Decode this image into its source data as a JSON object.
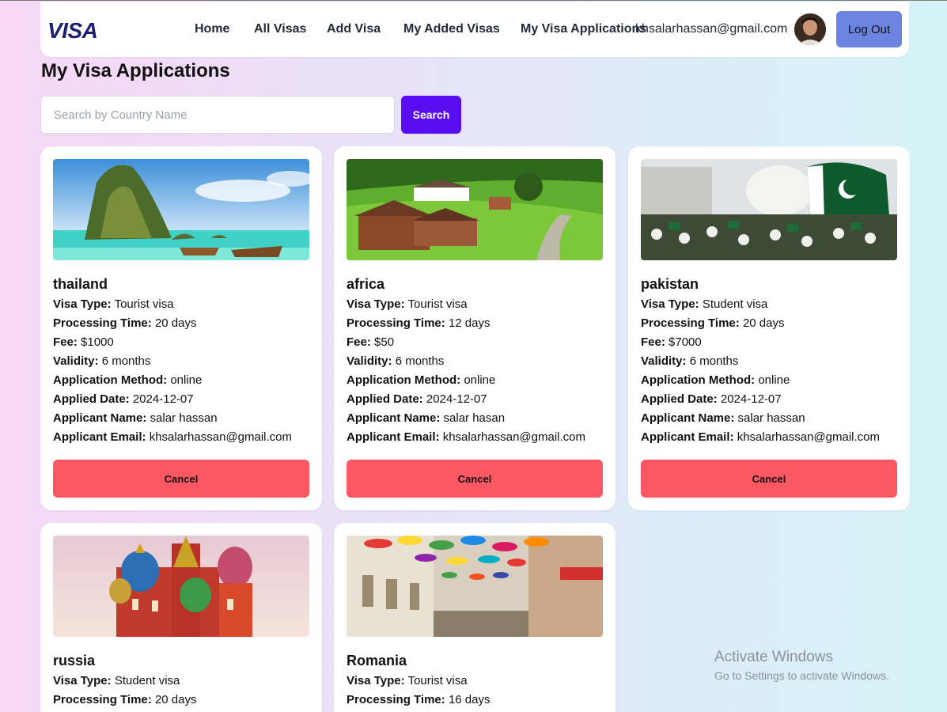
{
  "navbar": {
    "logo": "VISA",
    "links": [
      "Home",
      "All Visas",
      "Add Visa",
      "My Added Visas",
      "My Visa Applications"
    ],
    "user_email": "khsalarhassan@gmail.com",
    "logout_label": "Log Out"
  },
  "page": {
    "title": "My Visa Applications"
  },
  "search": {
    "placeholder": "Search by Country Name",
    "button_label": "Search"
  },
  "labels": {
    "visa_type": "Visa Type:",
    "processing_time": "Processing Time:",
    "fee": "Fee:",
    "validity": "Validity:",
    "application_method": "Application Method:",
    "applied_date": "Applied Date:",
    "applicant_name": "Applicant Name:",
    "applicant_email": "Applicant Email:",
    "cancel": "Cancel"
  },
  "applications": [
    {
      "country": "thailand",
      "visa_type": "Tourist visa",
      "processing_time": "20 days",
      "fee": "$1000",
      "validity": "6 months",
      "application_method": "online",
      "applied_date": "2024-12-07",
      "applicant_name": "salar hassan",
      "applicant_email": "khsalarhassan@gmail.com",
      "image": "thailand-beach-photo"
    },
    {
      "country": "africa",
      "visa_type": "Tourist visa",
      "processing_time": "12 days",
      "fee": "$50",
      "validity": "6 months",
      "application_method": "online",
      "applied_date": "2024-12-07",
      "applicant_name": "salar hasan",
      "applicant_email": "khsalarhassan@gmail.com",
      "image": "green-village-photo"
    },
    {
      "country": "pakistan",
      "visa_type": "Student visa",
      "processing_time": "20 days",
      "fee": "$7000",
      "validity": "6 months",
      "application_method": "online",
      "applied_date": "2024-12-07",
      "applicant_name": "salar hassan",
      "applicant_email": "khsalarhassan@gmail.com",
      "image": "pakistan-flags-photo"
    },
    {
      "country": "russia",
      "visa_type": "Student visa",
      "processing_time": "20 days",
      "image": "moscow-cathedral-photo"
    },
    {
      "country": "Romania",
      "visa_type": "Tourist visa",
      "processing_time": "16 days",
      "image": "umbrella-street-photo"
    }
  ],
  "watermark": {
    "title": "Activate Windows",
    "subtitle": "Go to Settings to activate Windows."
  }
}
